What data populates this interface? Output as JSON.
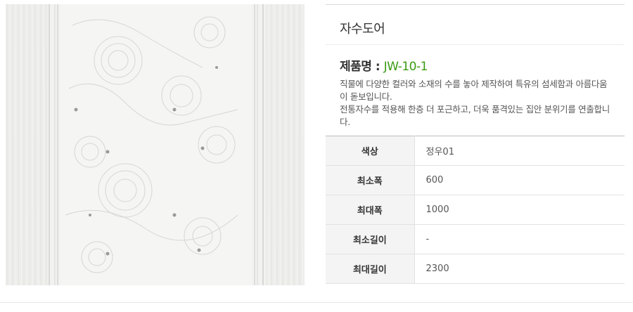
{
  "product": {
    "category": "자수도어",
    "name_label": "제품명",
    "name_sep": ":",
    "code": "JW-10-1",
    "description_line1": "직물에 다양한 컬러와 소재의 수를 놓아 제작하여 특유의 섬세함과 아름다움이 돋보입니다.",
    "description_line2": "전통자수를 적용해 한층 더 포근하고, 더욱 품격있는 집안 분위기를 연출합니다.",
    "image_alt": "embroidered-door-panel"
  },
  "specs": [
    {
      "label": "색상",
      "value": "정우01"
    },
    {
      "label": "최소폭",
      "value": "600"
    },
    {
      "label": "최대폭",
      "value": "1000"
    },
    {
      "label": "최소길이",
      "value": "-"
    },
    {
      "label": "최대길이",
      "value": "2300"
    }
  ],
  "colors": {
    "accent": "#3a9a12",
    "door": "#eeeeec"
  }
}
